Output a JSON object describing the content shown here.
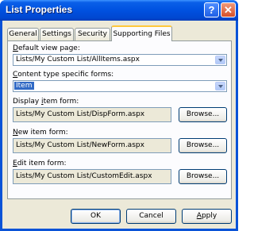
{
  "window": {
    "title": "List Properties",
    "help_label": "?",
    "close_label": "✕"
  },
  "tabs": [
    {
      "label": "General",
      "active": false
    },
    {
      "label": "Settings",
      "active": false
    },
    {
      "label": "Security",
      "active": false
    },
    {
      "label": "Supporting Files",
      "active": true
    }
  ],
  "default_view": {
    "label_pre": "",
    "label_u": "D",
    "label_post": "efault view page:",
    "value": "Lists/My Custom List/AllItems.aspx"
  },
  "content_type": {
    "label_pre": "",
    "label_u": "C",
    "label_post": "ontent type specific forms:",
    "value": "Item"
  },
  "display_form": {
    "label_pre": "Display ",
    "label_u": "i",
    "label_post": "tem form:",
    "value": "Lists/My Custom List/DispForm.aspx",
    "browse_label": "Browse..."
  },
  "new_form": {
    "label_pre": "",
    "label_u": "N",
    "label_post": "ew item form:",
    "value": "Lists/My Custom List/NewForm.aspx",
    "browse_label": "Browse..."
  },
  "edit_form": {
    "label_pre": "",
    "label_u": "E",
    "label_post": "dit item form:",
    "value": "Lists/My Custom List/CustomEdit.aspx",
    "browse_label": "Browse..."
  },
  "buttons": {
    "ok": "OK",
    "cancel": "Cancel",
    "apply_u": "A",
    "apply_post": "pply"
  }
}
